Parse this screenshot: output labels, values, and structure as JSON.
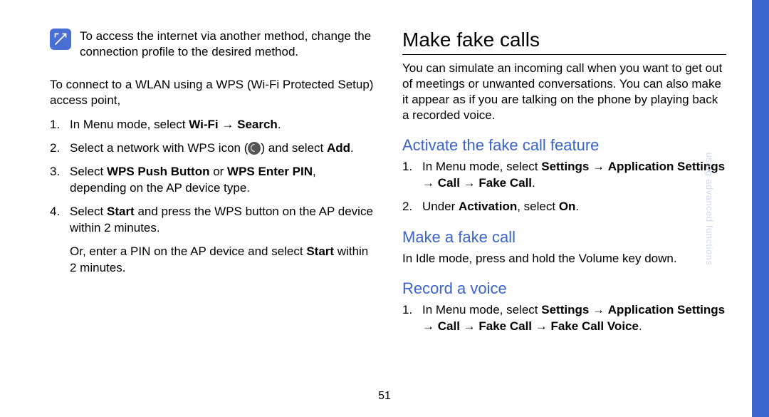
{
  "left": {
    "note": "To access the internet via another method, change the connection profile to the desired method.",
    "intro": "To connect to a WLAN using a WPS (Wi-Fi Protected Setup) access point,",
    "steps": {
      "s1_pre": "In Menu mode, select ",
      "s1_b1": "Wi-Fi",
      "s1_arrow": " → ",
      "s1_b2": "Search",
      "s1_post": ".",
      "s2_pre": "Select a network with WPS icon (",
      "s2_post": ") and select ",
      "s2_b": "Add",
      "s2_end": ".",
      "s3_pre": "Select ",
      "s3_b1": "WPS Push Button",
      "s3_mid": " or ",
      "s3_b2": "WPS Enter PIN",
      "s3_post": ", depending on the AP device type.",
      "s4_pre": "Select ",
      "s4_b": "Start",
      "s4_post": " and press the WPS button on the AP device within 2 minutes.",
      "s4_or_pre": "Or, enter a PIN on the AP device and select ",
      "s4_or_b": "Start",
      "s4_or_post": " within 2 minutes."
    }
  },
  "right": {
    "title": "Make fake calls",
    "intro": "You can simulate an incoming call when you want to get out of meetings or unwanted conversations. You can also make it appear as if you are talking on the phone by playing back a recorded voice.",
    "sub1": "Activate the fake call feature",
    "sub1_steps": {
      "s1_pre": "In Menu mode, select ",
      "s1_b1": "Settings",
      "s1_a1": " → ",
      "s1_b2": "Application Settings",
      "s1_a2": " → ",
      "s1_b3": "Call",
      "s1_a3": " → ",
      "s1_b4": "Fake Call",
      "s1_post": ".",
      "s2_pre": "Under ",
      "s2_b1": "Activation",
      "s2_mid": ", select ",
      "s2_b2": "On",
      "s2_post": "."
    },
    "sub2": "Make a fake call",
    "sub2_text": "In Idle mode, press and hold the Volume key down.",
    "sub3": "Record a voice",
    "sub3_steps": {
      "s1_pre": "In Menu mode, select ",
      "s1_b1": "Settings",
      "s1_a1": " → ",
      "s1_b2": "Application Settings",
      "s1_a2": " → ",
      "s1_b3": "Call",
      "s1_a3": " → ",
      "s1_b4": "Fake Call",
      "s1_a4": " → ",
      "s1_b5": "Fake Call Voice",
      "s1_post": "."
    }
  },
  "page_number": "51",
  "side_tab": "using advanced functions"
}
